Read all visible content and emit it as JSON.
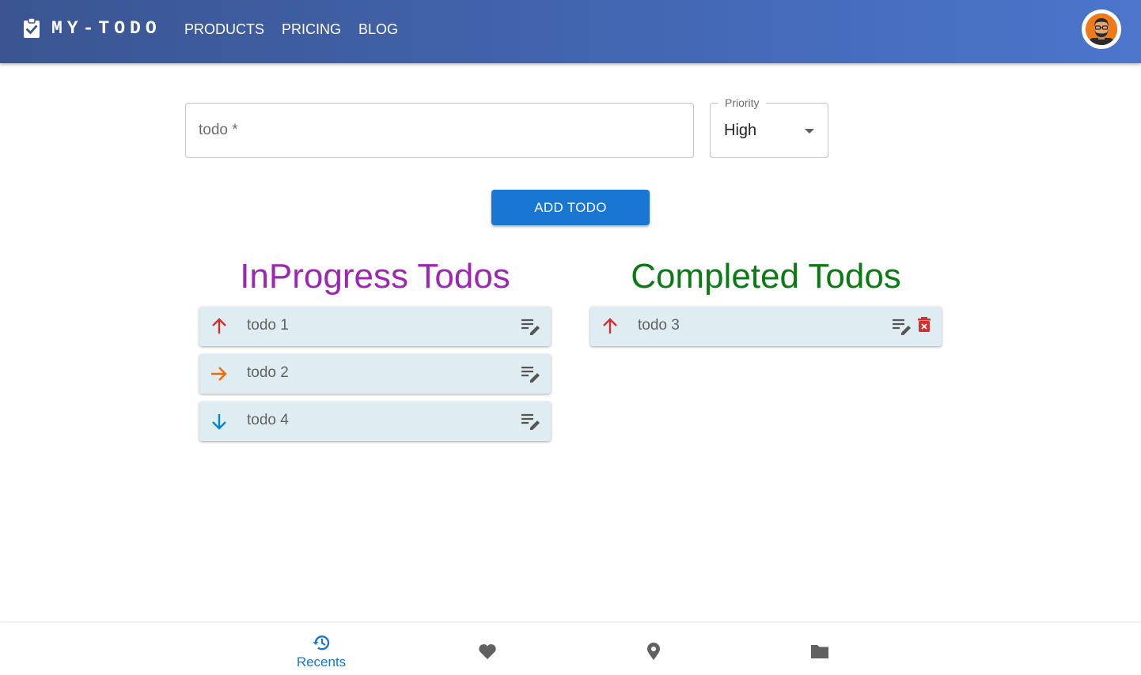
{
  "app": {
    "brand": "MY-TODO",
    "nav": [
      "PRODUCTS",
      "PRICING",
      "BLOG"
    ]
  },
  "form": {
    "todo_placeholder": "todo *",
    "todo_value": "",
    "priority_label": "Priority",
    "priority_value": "High",
    "add_button": "ADD TODO"
  },
  "inprogress": {
    "title": "InProgress Todos",
    "items": [
      {
        "text": "todo 1",
        "priority": "High"
      },
      {
        "text": "todo 2",
        "priority": "Medium"
      },
      {
        "text": "todo 4",
        "priority": "Low"
      }
    ]
  },
  "completed": {
    "title": "Completed Todos",
    "items": [
      {
        "text": "todo 3",
        "priority": "High"
      }
    ]
  },
  "bottom_nav": {
    "items": [
      {
        "icon": "history-icon",
        "label": "Recents",
        "active": true
      },
      {
        "icon": "heart-icon",
        "label": "",
        "active": false
      },
      {
        "icon": "location-pin-icon",
        "label": "",
        "active": false
      },
      {
        "icon": "folder-icon",
        "label": "",
        "active": false
      }
    ]
  },
  "colors": {
    "appbar_start": "#3a5591",
    "appbar_end": "#4b76cc",
    "primary": "#1976d2",
    "inprogress_title": "#9c27b0",
    "completed_title": "#0a7a12",
    "priority_high": "#d32f2f",
    "priority_medium": "#ef6c00",
    "priority_low": "#0288d1",
    "card_bg": "#dfedf2"
  }
}
